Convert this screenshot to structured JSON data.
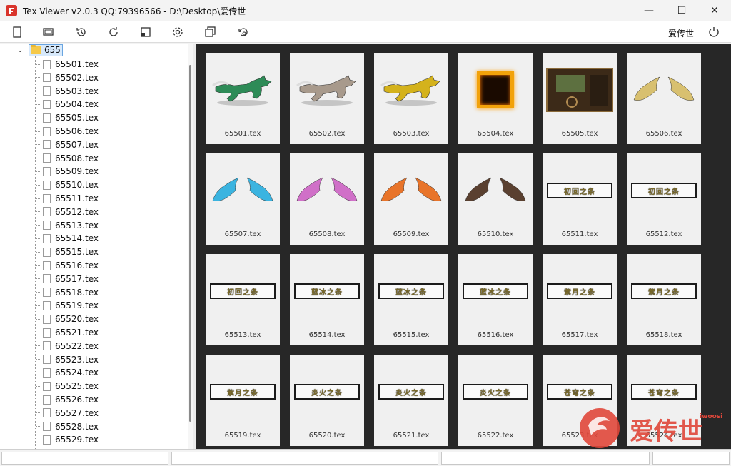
{
  "window": {
    "title": "Tex Viewer v2.0.3 QQ:79396566 - D:\\Desktop\\爱传世",
    "minimize": "—",
    "maximize": "☐",
    "close": "✕"
  },
  "toolbar": {
    "buttons": [
      {
        "name": "new-icon"
      },
      {
        "name": "layers-icon"
      },
      {
        "name": "history-icon"
      },
      {
        "name": "refresh-icon"
      },
      {
        "name": "square-icon"
      },
      {
        "name": "gear-icon"
      },
      {
        "name": "copy-icon"
      },
      {
        "name": "rotate-icon"
      }
    ],
    "user_label": "爱传世"
  },
  "tree": {
    "root_label": "655",
    "items": [
      "65501.tex",
      "65502.tex",
      "65503.tex",
      "65504.tex",
      "65505.tex",
      "65506.tex",
      "65507.tex",
      "65508.tex",
      "65509.tex",
      "65510.tex",
      "65511.tex",
      "65512.tex",
      "65513.tex",
      "65514.tex",
      "65515.tex",
      "65516.tex",
      "65517.tex",
      "65518.tex",
      "65519.tex",
      "65520.tex",
      "65521.tex",
      "65522.tex",
      "65523.tex",
      "65524.tex",
      "65525.tex",
      "65526.tex",
      "65527.tex",
      "65528.tex",
      "65529.tex"
    ]
  },
  "gallery": {
    "cards": [
      {
        "label": "65501.tex",
        "kind": "horse",
        "color": "#2e8b57"
      },
      {
        "label": "65502.tex",
        "kind": "horse",
        "color": "#a89a8c"
      },
      {
        "label": "65503.tex",
        "kind": "horse",
        "color": "#d4b21c"
      },
      {
        "label": "65504.tex",
        "kind": "frame"
      },
      {
        "label": "65505.tex",
        "kind": "screen"
      },
      {
        "label": "65506.tex",
        "kind": "wings",
        "color": "#d8c070"
      },
      {
        "label": "65507.tex",
        "kind": "wings",
        "color": "#3bb4e0"
      },
      {
        "label": "65508.tex",
        "kind": "wings",
        "color": "#d070c8"
      },
      {
        "label": "65509.tex",
        "kind": "wings",
        "color": "#e8742a"
      },
      {
        "label": "65510.tex",
        "kind": "wings",
        "color": "#5a4030"
      },
      {
        "label": "65511.tex",
        "kind": "plate",
        "text": "初回之条"
      },
      {
        "label": "65512.tex",
        "kind": "plate",
        "text": "初回之条"
      },
      {
        "label": "65513.tex",
        "kind": "plate",
        "text": "初回之条"
      },
      {
        "label": "65514.tex",
        "kind": "plate",
        "text": "蓝冰之条"
      },
      {
        "label": "65515.tex",
        "kind": "plate",
        "text": "蓝冰之条"
      },
      {
        "label": "65516.tex",
        "kind": "plate",
        "text": "蓝冰之条"
      },
      {
        "label": "65517.tex",
        "kind": "plate",
        "text": "紫月之条"
      },
      {
        "label": "65518.tex",
        "kind": "plate",
        "text": "紫月之条"
      },
      {
        "label": "65519.tex",
        "kind": "plate",
        "text": "紫月之条"
      },
      {
        "label": "65520.tex",
        "kind": "plate",
        "text": "炎火之条"
      },
      {
        "label": "65521.tex",
        "kind": "plate",
        "text": "炎火之条"
      },
      {
        "label": "65522.tex",
        "kind": "plate",
        "text": "炎火之条"
      },
      {
        "label": "65523.tex",
        "kind": "plate",
        "text": "苍穹之条"
      },
      {
        "label": "65524.tex",
        "kind": "plate",
        "text": "苍穹之条"
      }
    ]
  },
  "watermark": {
    "text": "爱传世",
    "small": "iwoosi",
    "color": "#e0473a"
  }
}
